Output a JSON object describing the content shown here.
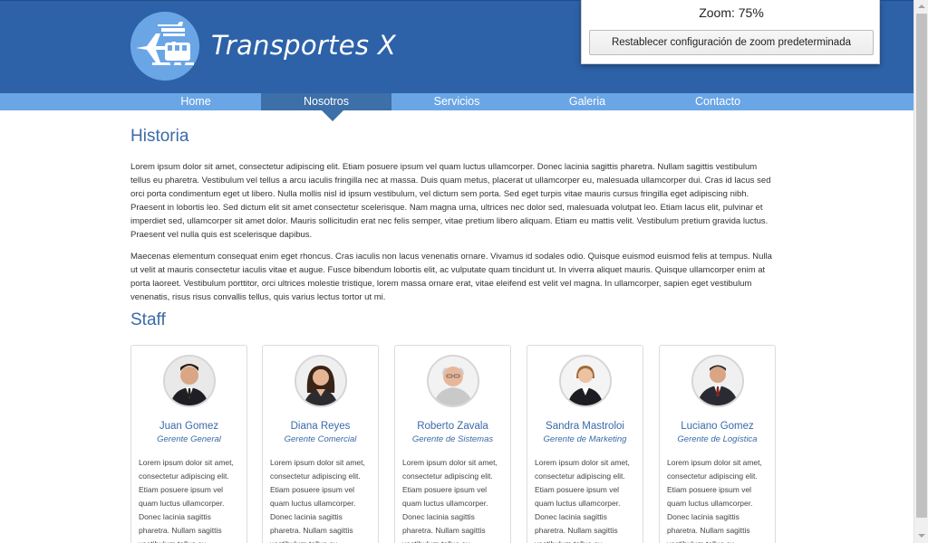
{
  "site": {
    "title": "Transportes X",
    "logo_icon": "plane-train-ship-icon",
    "header_color": "#2d62a8",
    "nav_color": "#6aa6e6",
    "accent_color": "#3a6aa8"
  },
  "nav": {
    "items": [
      {
        "label": "Home",
        "active": false
      },
      {
        "label": "Nosotros",
        "active": true
      },
      {
        "label": "Servicios",
        "active": false
      },
      {
        "label": "Galeria",
        "active": false
      },
      {
        "label": "Contacto",
        "active": false
      }
    ]
  },
  "historia": {
    "heading": "Historia",
    "paragraphs": [
      "Lorem ipsum dolor sit amet, consectetur adipiscing elit. Etiam posuere ipsum vel quam luctus ullamcorper. Donec lacinia sagittis pharetra. Nullam sagittis vestibulum tellus eu pharetra. Vestibulum vel tellus a arcu iaculis fringilla nec at massa. Duis quam metus, placerat ut ullamcorper eu, malesuada ullamcorper dui. Cras id lacus sed orci porta condimentum eget ut libero. Nulla mollis nisl id ipsum vestibulum, vel dictum sem porta. Sed eget turpis vitae mauris cursus fringilla eget adipiscing nibh. Praesent in lobortis leo. Sed dictum elit sit amet consectetur scelerisque. Nam magna urna, ultrices nec dolor sed, malesuada volutpat leo. Etiam lacus elit, pulvinar et imperdiet sed, ullamcorper sit amet dolor. Mauris sollicitudin erat nec felis semper, vitae pretium libero aliquam. Etiam eu mattis velit. Vestibulum pretium gravida luctus. Praesent vel nulla quis est scelerisque dapibus.",
      "Maecenas elementum consequat enim eget rhoncus. Cras iaculis non lacus venenatis ornare. Vivamus id sodales odio. Quisque euismod euismod felis at tempus. Nulla ut velit at mauris consectetur iaculis vitae et augue. Fusce bibendum lobortis elit, ac vulputate quam tincidunt ut. In viverra aliquet mauris. Quisque ullamcorper enim at porta laoreet. Vestibulum porttitor, orci ultrices molestie tristique, lorem massa ornare erat, vitae eleifend est velit vel magna. In ullamcorper, sapien eget vestibulum venenatis, risus risus convallis tellus, quis varius lectus tortor ut mi."
    ]
  },
  "staff": {
    "heading": "Staff",
    "members": [
      {
        "name": "Juan Gomez",
        "role": "Gerente General",
        "bio": "Lorem ipsum dolor sit amet, consectetur adipiscing elit. Etiam posuere ipsum vel quam luctus ullamcorper. Donec lacinia sagittis pharetra. Nullam sagittis vestibulum tellus eu",
        "avatar_icon": "man-in-suit-avatar"
      },
      {
        "name": "Diana Reyes",
        "role": "Gerente Comercial",
        "bio": "Lorem ipsum dolor sit amet, consectetur adipiscing elit. Etiam posuere ipsum vel quam luctus ullamcorper. Donec lacinia sagittis pharetra. Nullam sagittis vestibulum tellus eu",
        "avatar_icon": "woman-avatar"
      },
      {
        "name": "Roberto Zavala",
        "role": "Gerente de Sistemas",
        "bio": "Lorem ipsum dolor sit amet, consectetur adipiscing elit. Etiam posuere ipsum vel quam luctus ullamcorper. Donec lacinia sagittis pharetra. Nullam sagittis vestibulum tellus eu",
        "avatar_icon": "older-man-avatar"
      },
      {
        "name": "Sandra Mastroloi",
        "role": "Gerente de Marketing",
        "bio": "Lorem ipsum dolor sit amet, consectetur adipiscing elit. Etiam posuere ipsum vel quam luctus ullamcorper. Donec lacinia sagittis pharetra. Nullam sagittis vestibulum tellus eu",
        "avatar_icon": "businesswoman-avatar"
      },
      {
        "name": "Luciano Gomez",
        "role": "Gerente de Logística",
        "bio": "Lorem ipsum dolor sit amet, consectetur adipiscing elit. Etiam posuere ipsum vel quam luctus ullamcorper. Donec lacinia sagittis pharetra. Nullam sagittis vestibulum tellus eu",
        "avatar_icon": "businessman-avatar"
      }
    ]
  },
  "zoom": {
    "label": "Zoom: 75%",
    "reset_label": "Restablecer configuración de zoom predeterminada"
  }
}
